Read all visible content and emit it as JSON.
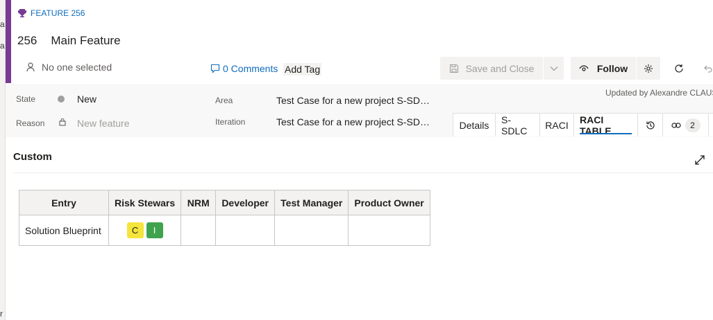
{
  "left_strip": {
    "glyphs": [
      "a",
      "a",
      "r"
    ]
  },
  "work_item": {
    "type_label": "FEATURE 256",
    "id": "256",
    "title": "Main Feature",
    "assignee": "No one selected",
    "comments": "0 Comments",
    "add_tag": "Add Tag"
  },
  "toolbar": {
    "save_label": "Save and Close",
    "follow_label": "Follow"
  },
  "fields": {
    "state_label": "State",
    "state_value": "New",
    "reason_label": "Reason",
    "reason_value": "New feature",
    "area_label": "Area",
    "area_value": "Test Case for a new project S-SD…",
    "iteration_label": "Iteration",
    "iteration_value": "Test Case for a new project S-SD…",
    "updated_by": "Updated by Alexandre CLAUS"
  },
  "tabs": [
    {
      "label": "Details"
    },
    {
      "label": "S-SDLC"
    },
    {
      "label": "RACI"
    },
    {
      "label": "RACI TABLE",
      "active": true
    }
  ],
  "links_count": "2",
  "section": {
    "title": "Custom"
  },
  "raci_table": {
    "headers": [
      "Entry",
      "Risk Stewars",
      "NRM",
      "Developer",
      "Test Manager",
      "Product Owner"
    ],
    "rows": [
      {
        "entry": "Solution Blueprint",
        "risk_stewars": [
          "C",
          "I"
        ],
        "nrm": "",
        "developer": "",
        "test_manager": "",
        "product_owner": ""
      }
    ]
  },
  "colors": {
    "accent": "#773b93",
    "link": "#0f6cbd",
    "chip_c": "#f4e43c",
    "chip_i": "#3fa34d"
  }
}
